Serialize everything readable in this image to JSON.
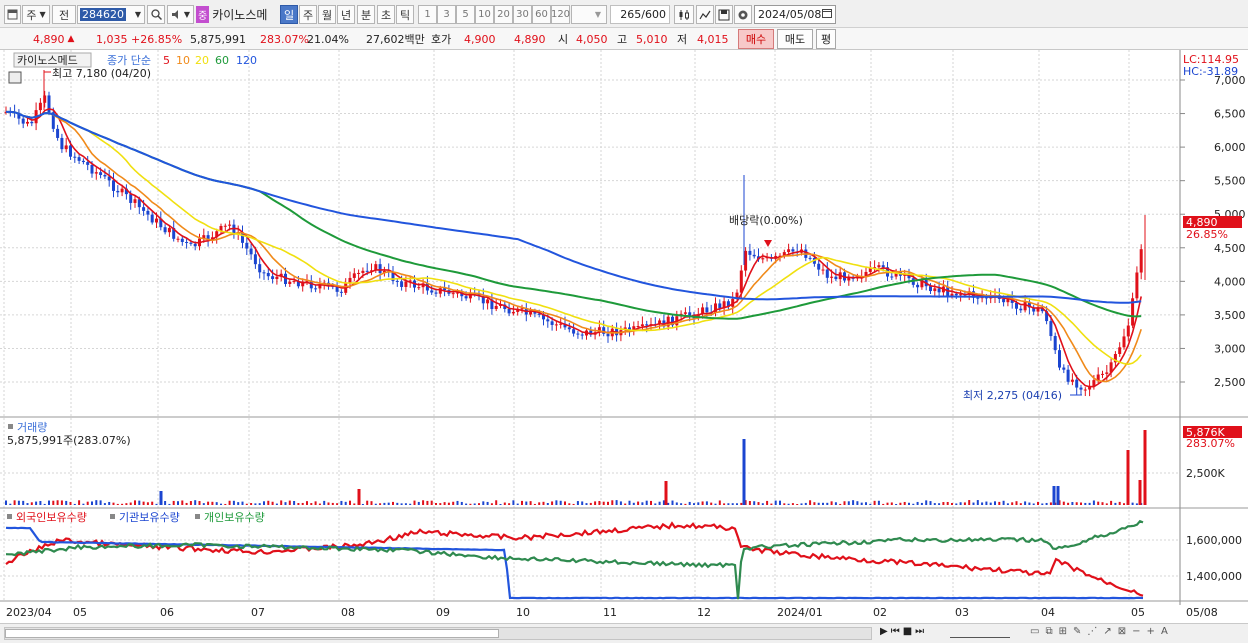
{
  "toolbar": {
    "market_type": "주",
    "prev_label": "전",
    "code": "284620",
    "stock_badge": "중",
    "stock_name": "카이노스메",
    "period_buttons": [
      "일",
      "주",
      "월",
      "년",
      "분",
      "초",
      "틱"
    ],
    "active_period": "일",
    "minute_buttons": [
      "1",
      "3",
      "5",
      "10",
      "20",
      "30",
      "60",
      "120"
    ],
    "count": "265",
    "count_total": "/600",
    "date": "2024/05/08"
  },
  "quote": {
    "price": "4,890",
    "change": "1,035",
    "change_pct": "+26.85%",
    "volume": "5,875,991",
    "volume_ratio": "283.07%",
    "turnover": "21.04%",
    "amount": "27,602백만",
    "ask_label": "호가",
    "ask": "4,900",
    "bid": "4,890",
    "open_label": "시",
    "open": "4,050",
    "high_label": "고",
    "high": "5,010",
    "low_label": "저",
    "low": "4,015",
    "buy_label": "매수",
    "sell_label": "매도",
    "eval_label": "평"
  },
  "chart": {
    "stock_tag": "카이노스메드",
    "ma_title": "종가 단순",
    "ma_periods": [
      "5",
      "10",
      "20",
      "60",
      "120"
    ],
    "ma_colors": [
      "#e0101a",
      "#f08a1a",
      "#f0e010",
      "#1e9a3a",
      "#2255dd"
    ],
    "lc": "LC:114.95",
    "hc": "HC:-31.89",
    "high_marker": "최고 7,180 (04/20)",
    "low_marker": "최저 2,275 (04/16)",
    "dividend_marker": "배당락(0.00%)",
    "price_axis": [
      "7,000",
      "6,500",
      "6,000",
      "5,500",
      "5,000",
      "4,500",
      "4,000",
      "3,500",
      "3,000",
      "2,500"
    ],
    "current_price_tag": "4,890",
    "current_pct_tag": "26.85%",
    "volume_title": "거래량",
    "volume_value": "5,875,991주(283.07%)",
    "volume_tag": "5,876K",
    "volume_pct": "283.07%",
    "volume_axis": [
      "2,500K"
    ],
    "holdings_legend": [
      "외국인보유수량",
      "기관보유수량",
      "개인보유수량"
    ],
    "holdings_axis": [
      "1,600,000",
      "1,400,000"
    ],
    "date_axis": [
      "2023/04",
      "05",
      "06",
      "07",
      "08",
      "09",
      "10",
      "11",
      "12",
      "2024/01",
      "02",
      "03",
      "04",
      "05"
    ],
    "date_axis_right": "05/08"
  },
  "chart_data": [
    {
      "type": "candlestick",
      "title": "카이노스메드",
      "ylim": [
        2275,
        7180
      ],
      "ma_periods": [
        5,
        10,
        20,
        60,
        120
      ],
      "series": [
        {
          "name": "종가",
          "x": [
            "2023/04",
            "2023/05",
            "2023/06",
            "2023/07",
            "2023/08",
            "2023/09",
            "2023/10",
            "2023/11",
            "2023/12",
            "2024/01",
            "2024/02",
            "2024/03",
            "2024/04",
            "2024/05/08"
          ],
          "values": [
            6300,
            5200,
            4500,
            4100,
            4000,
            3700,
            3350,
            3200,
            3600,
            4400,
            4100,
            3800,
            2500,
            4890
          ]
        }
      ],
      "annotations": [
        "최고 7,180 (04/20)",
        "최저 2,275 (04/16)",
        "배당락(0.00%)"
      ]
    },
    {
      "type": "bar",
      "title": "거래량",
      "series": [
        {
          "name": "거래량",
          "x": [
            "2024/05/08"
          ],
          "values": [
            5875991
          ]
        }
      ]
    },
    {
      "type": "line",
      "series": [
        {
          "name": "외국인보유수량"
        },
        {
          "name": "기관보유수량"
        },
        {
          "name": "개인보유수량"
        }
      ]
    }
  ]
}
